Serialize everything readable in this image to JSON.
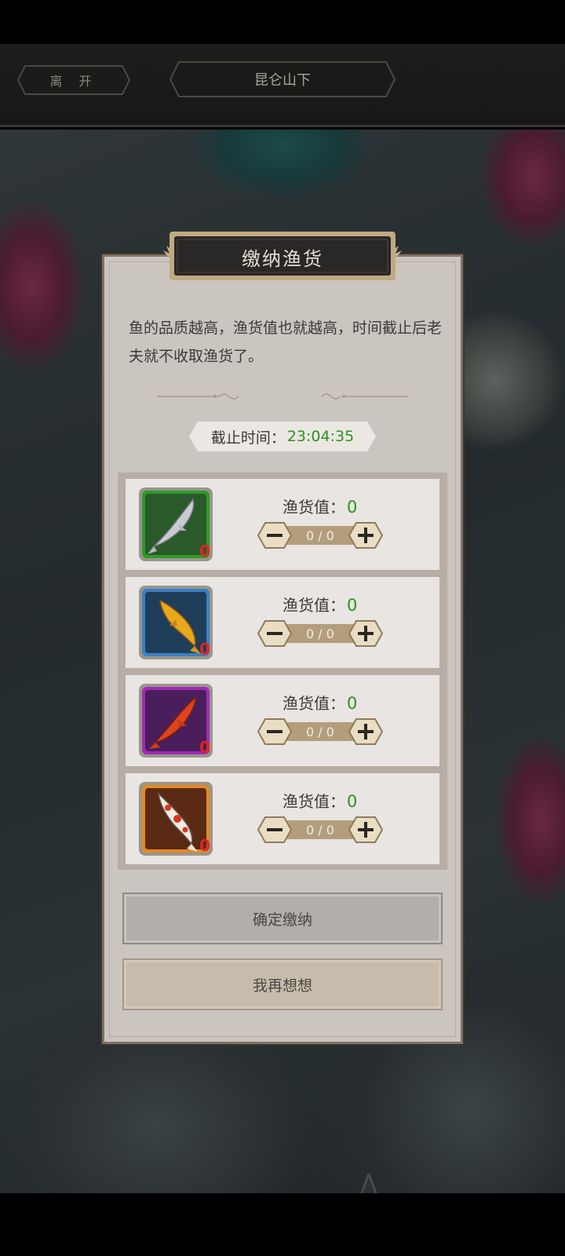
{
  "header": {
    "leave_label": "离 开",
    "location": "昆仑山下"
  },
  "dialog": {
    "title": "缴纳渔货",
    "description": "鱼的品质越高，渔货值也就越高，时间截止后老夫就不收取渔货了。",
    "deadline_label": "截止时间：",
    "deadline_time": "23:04:35",
    "items": [
      {
        "fish": "silver-koi-icon",
        "rarity_color": "#2e9a2a",
        "count": "0",
        "value_label": "渔货值：",
        "value": "0",
        "qty": "0 / 0"
      },
      {
        "fish": "golden-koi-icon",
        "rarity_color": "#3a7fc4",
        "count": "0",
        "value_label": "渔货值：",
        "value": "0",
        "qty": "0 / 0"
      },
      {
        "fish": "red-koi-icon",
        "rarity_color": "#a02ab8",
        "count": "0",
        "value_label": "渔货值：",
        "value": "0",
        "qty": "0 / 0"
      },
      {
        "fish": "spotted-koi-icon",
        "rarity_color": "#e58a1f",
        "count": "0",
        "value_label": "渔货值：",
        "value": "0",
        "qty": "0 / 0"
      }
    ],
    "confirm_label": "确定缴纳",
    "cancel_label": "我再想想"
  }
}
